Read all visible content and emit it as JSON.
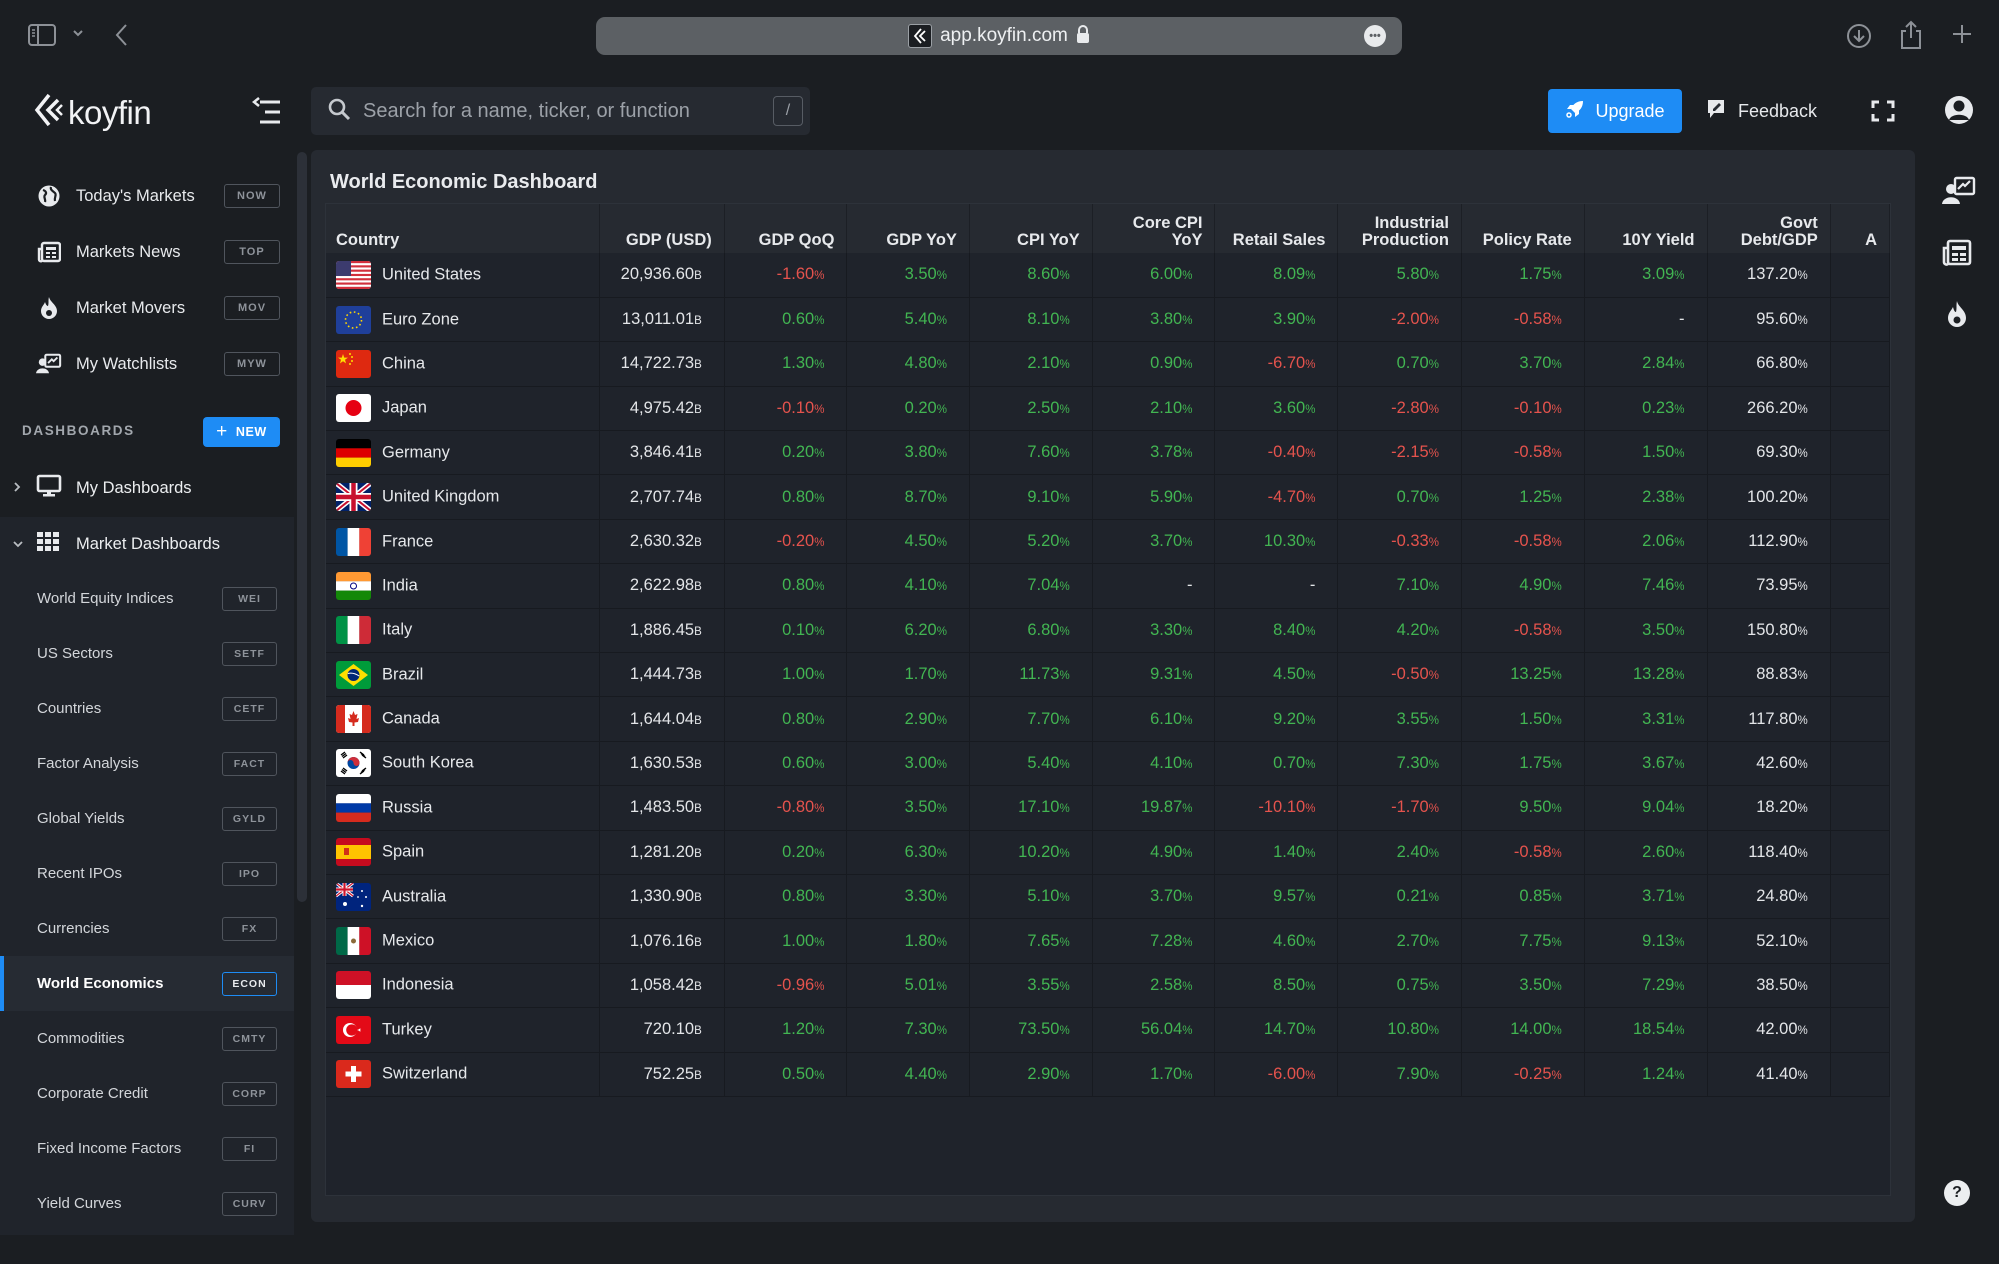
{
  "browser": {
    "url": "app.koyfin.com",
    "icons": [
      "sidebar-toggle-icon",
      "chevron-down-icon",
      "back-icon",
      "lock-icon",
      "more-icon",
      "download-icon",
      "share-icon",
      "new-tab-icon"
    ]
  },
  "header": {
    "logo_text": "koyfin",
    "search_placeholder": "Search for a name, ticker, or function",
    "search_shortcut": "/",
    "upgrade_label": "Upgrade",
    "feedback_label": "Feedback"
  },
  "sidebar": {
    "top_items": [
      {
        "label": "Today's Markets",
        "tag": "NOW",
        "icon": "globe-icon"
      },
      {
        "label": "Markets News",
        "tag": "TOP",
        "icon": "newspaper-icon"
      },
      {
        "label": "Market Movers",
        "tag": "MOV",
        "icon": "flame-icon"
      },
      {
        "label": "My Watchlists",
        "tag": "MYW",
        "icon": "watchlist-icon"
      }
    ],
    "dashboards_header": "DASHBOARDS",
    "new_label": "NEW",
    "tree": [
      {
        "label": "My Dashboards",
        "expanded": false
      },
      {
        "label": "Market Dashboards",
        "expanded": true
      }
    ],
    "sub_items": [
      {
        "label": "World Equity Indices",
        "tag": "WEI"
      },
      {
        "label": "US Sectors",
        "tag": "SETF"
      },
      {
        "label": "Countries",
        "tag": "CETF"
      },
      {
        "label": "Factor Analysis",
        "tag": "FACT"
      },
      {
        "label": "Global Yields",
        "tag": "GYLD"
      },
      {
        "label": "Recent IPOs",
        "tag": "IPO"
      },
      {
        "label": "Currencies",
        "tag": "FX"
      },
      {
        "label": "World Economics",
        "tag": "ECON",
        "active": true
      },
      {
        "label": "Commodities",
        "tag": "CMTY"
      },
      {
        "label": "Corporate Credit",
        "tag": "CORP"
      },
      {
        "label": "Fixed Income Factors",
        "tag": "FI"
      },
      {
        "label": "Yield Curves",
        "tag": "CURV"
      }
    ]
  },
  "dashboard": {
    "title": "World Economic Dashboard",
    "columns": [
      "Country",
      "GDP (USD)",
      "GDP QoQ",
      "GDP YoY",
      "CPI YoY",
      "Core CPI YoY",
      "Retail Sales",
      "Industrial Production",
      "Policy Rate",
      "10Y Yield",
      "Govt Debt/GDP",
      "A"
    ],
    "gdp_unit": "B",
    "pct_unit": "%",
    "colors": {
      "positive": "#42b552",
      "negative": "#e5534d",
      "accent": "#1e8cf5"
    },
    "rows": [
      {
        "country": "United States",
        "flag": "us",
        "gdp": "20,936.60",
        "v": [
          "-1.60",
          "3.50",
          "8.60",
          "6.00",
          "8.09",
          "5.80",
          "1.75",
          "3.09",
          "137.20"
        ]
      },
      {
        "country": "Euro Zone",
        "flag": "eu",
        "gdp": "13,011.01",
        "v": [
          "0.60",
          "5.40",
          "8.10",
          "3.80",
          "3.90",
          "-2.00",
          "-0.58",
          "-",
          "95.60"
        ]
      },
      {
        "country": "China",
        "flag": "cn",
        "gdp": "14,722.73",
        "v": [
          "1.30",
          "4.80",
          "2.10",
          "0.90",
          "-6.70",
          "0.70",
          "3.70",
          "2.84",
          "66.80"
        ]
      },
      {
        "country": "Japan",
        "flag": "jp",
        "gdp": "4,975.42",
        "v": [
          "-0.10",
          "0.20",
          "2.50",
          "2.10",
          "3.60",
          "-2.80",
          "-0.10",
          "0.23",
          "266.20"
        ]
      },
      {
        "country": "Germany",
        "flag": "de",
        "gdp": "3,846.41",
        "v": [
          "0.20",
          "3.80",
          "7.60",
          "3.78",
          "-0.40",
          "-2.15",
          "-0.58",
          "1.50",
          "69.30"
        ]
      },
      {
        "country": "United Kingdom",
        "flag": "gb",
        "gdp": "2,707.74",
        "v": [
          "0.80",
          "8.70",
          "9.10",
          "5.90",
          "-4.70",
          "0.70",
          "1.25",
          "2.38",
          "100.20"
        ]
      },
      {
        "country": "France",
        "flag": "fr",
        "gdp": "2,630.32",
        "v": [
          "-0.20",
          "4.50",
          "5.20",
          "3.70",
          "10.30",
          "-0.33",
          "-0.58",
          "2.06",
          "112.90"
        ]
      },
      {
        "country": "India",
        "flag": "in",
        "gdp": "2,622.98",
        "v": [
          "0.80",
          "4.10",
          "7.04",
          "-",
          "-",
          "7.10",
          "4.90",
          "7.46",
          "73.95"
        ]
      },
      {
        "country": "Italy",
        "flag": "it",
        "gdp": "1,886.45",
        "v": [
          "0.10",
          "6.20",
          "6.80",
          "3.30",
          "8.40",
          "4.20",
          "-0.58",
          "3.50",
          "150.80"
        ]
      },
      {
        "country": "Brazil",
        "flag": "br",
        "gdp": "1,444.73",
        "v": [
          "1.00",
          "1.70",
          "11.73",
          "9.31",
          "4.50",
          "-0.50",
          "13.25",
          "13.28",
          "88.83"
        ]
      },
      {
        "country": "Canada",
        "flag": "ca",
        "gdp": "1,644.04",
        "v": [
          "0.80",
          "2.90",
          "7.70",
          "6.10",
          "9.20",
          "3.55",
          "1.50",
          "3.31",
          "117.80"
        ]
      },
      {
        "country": "South Korea",
        "flag": "kr",
        "gdp": "1,630.53",
        "v": [
          "0.60",
          "3.00",
          "5.40",
          "4.10",
          "0.70",
          "7.30",
          "1.75",
          "3.67",
          "42.60"
        ]
      },
      {
        "country": "Russia",
        "flag": "ru",
        "gdp": "1,483.50",
        "v": [
          "-0.80",
          "3.50",
          "17.10",
          "19.87",
          "-10.10",
          "-1.70",
          "9.50",
          "9.04",
          "18.20"
        ]
      },
      {
        "country": "Spain",
        "flag": "es",
        "gdp": "1,281.20",
        "v": [
          "0.20",
          "6.30",
          "10.20",
          "4.90",
          "1.40",
          "2.40",
          "-0.58",
          "2.60",
          "118.40"
        ]
      },
      {
        "country": "Australia",
        "flag": "au",
        "gdp": "1,330.90",
        "v": [
          "0.80",
          "3.30",
          "5.10",
          "3.70",
          "9.57",
          "0.21",
          "0.85",
          "3.71",
          "24.80"
        ]
      },
      {
        "country": "Mexico",
        "flag": "mx",
        "gdp": "1,076.16",
        "v": [
          "1.00",
          "1.80",
          "7.65",
          "7.28",
          "4.60",
          "2.70",
          "7.75",
          "9.13",
          "52.10"
        ]
      },
      {
        "country": "Indonesia",
        "flag": "id",
        "gdp": "1,058.42",
        "v": [
          "-0.96",
          "5.01",
          "3.55",
          "2.58",
          "8.50",
          "0.75",
          "3.50",
          "7.29",
          "38.50"
        ]
      },
      {
        "country": "Turkey",
        "flag": "tr",
        "gdp": "720.10",
        "v": [
          "1.20",
          "7.30",
          "73.50",
          "56.04",
          "14.70",
          "10.80",
          "14.00",
          "18.54",
          "42.00"
        ]
      },
      {
        "country": "Switzerland",
        "flag": "ch",
        "gdp": "752.25",
        "v": [
          "0.50",
          "4.40",
          "2.90",
          "1.70",
          "-6.00",
          "7.90",
          "-0.25",
          "1.24",
          "41.40"
        ]
      }
    ]
  },
  "right_rail": {
    "icons": [
      "watchlist-icon",
      "newspaper-icon",
      "flame-icon"
    ],
    "help_label": "?"
  }
}
